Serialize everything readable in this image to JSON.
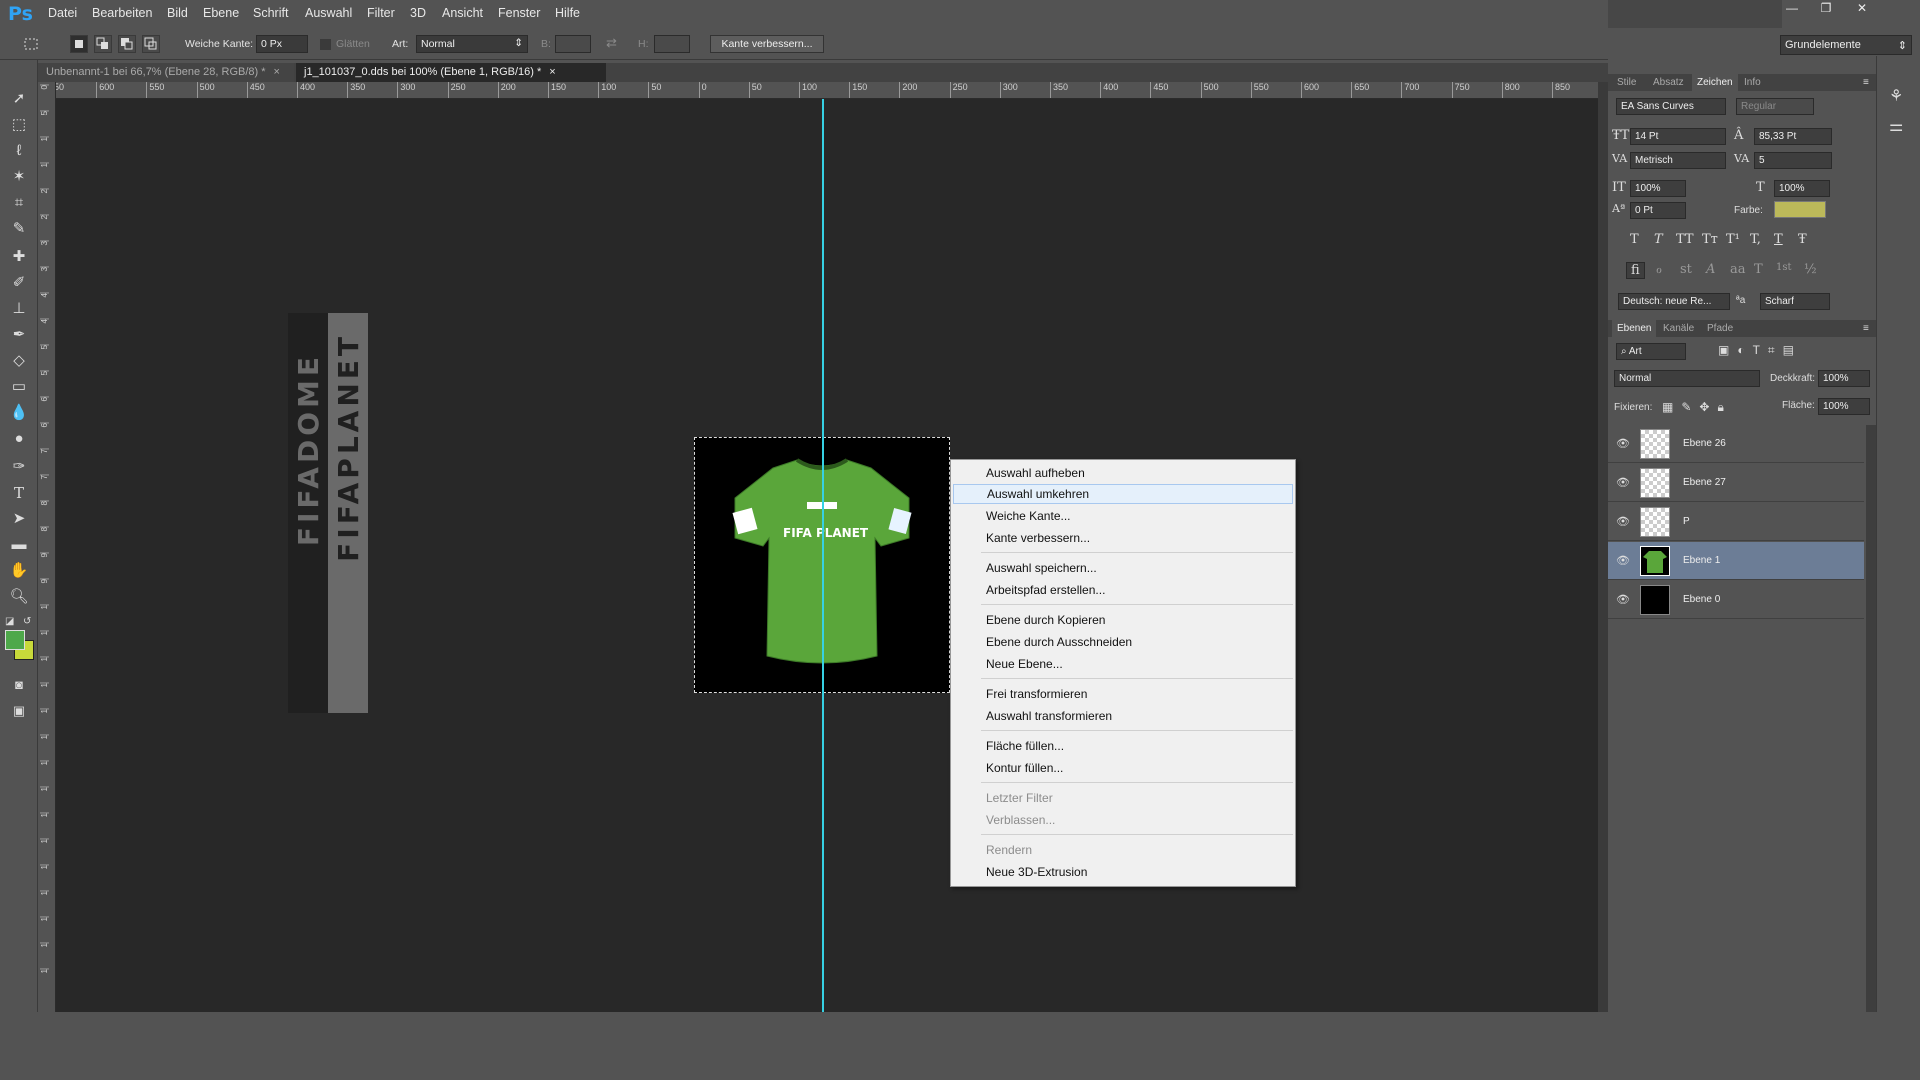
{
  "app": {
    "logo": "Ps"
  },
  "menu": [
    "Datei",
    "Bearbeiten",
    "Bild",
    "Ebene",
    "Schrift",
    "Auswahl",
    "Filter",
    "3D",
    "Ansicht",
    "Fenster",
    "Hilfe"
  ],
  "window_controls": {
    "minimize": "—",
    "restore": "❐",
    "close": "✕"
  },
  "options": {
    "feather_label": "Weiche Kante:",
    "feather_value": "0 Px",
    "antialias_label": "Glätten",
    "style_label": "Art:",
    "style_value": "Normal",
    "width_label": "B:",
    "height_label": "H:",
    "refine_button": "Kante verbessern..."
  },
  "workspace": "Grundelemente",
  "tabs": [
    {
      "label": "Unbenannt-1 bei 66,7% (Ebene 28, RGB/8) *",
      "close": "×"
    },
    {
      "label": "j1_101037_0.dds bei 100% (Ebene 1, RGB/16) *",
      "close": "×"
    }
  ],
  "ruler_h": [
    "650",
    "600",
    "550",
    "500",
    "450",
    "400",
    "350",
    "300",
    "250",
    "200",
    "150",
    "100",
    "50",
    "0",
    "50",
    "100",
    "150",
    "200",
    "250",
    "300",
    "350",
    "400",
    "450",
    "500",
    "550",
    "600",
    "650",
    "700",
    "750",
    "800",
    "850"
  ],
  "ruler_v": [
    "0",
    "5",
    "1",
    "1",
    "2",
    "2",
    "3",
    "3",
    "4",
    "4",
    "5",
    "5",
    "6",
    "6",
    "7",
    "7",
    "8",
    "8",
    "9",
    "9",
    "1",
    "1",
    "1",
    "1",
    "1",
    "1",
    "1",
    "1",
    "1",
    "1",
    "1",
    "1",
    "1",
    "1",
    "1"
  ],
  "canvas_logo": {
    "text_dark": "FIFADOME",
    "text_light": "FIFAPLANET"
  },
  "jersey_text": "FIFA PLANET",
  "context_menu": [
    {
      "label": "Auswahl aufheben",
      "disabled": false
    },
    {
      "label": "Auswahl umkehren",
      "disabled": false,
      "hover": true
    },
    {
      "label": "Weiche Kante...",
      "disabled": false
    },
    {
      "label": "Kante verbessern...",
      "disabled": false
    },
    {
      "label": "Auswahl speichern...",
      "disabled": false
    },
    {
      "label": "Arbeitspfad erstellen...",
      "disabled": false
    },
    {
      "label": "Ebene durch Kopieren",
      "disabled": false
    },
    {
      "label": "Ebene durch Ausschneiden",
      "disabled": false
    },
    {
      "label": "Neue Ebene...",
      "disabled": false
    },
    {
      "label": "Frei transformieren",
      "disabled": false
    },
    {
      "label": "Auswahl transformieren",
      "disabled": false
    },
    {
      "label": "Fläche füllen...",
      "disabled": false
    },
    {
      "label": "Kontur füllen...",
      "disabled": false
    },
    {
      "label": "Letzter Filter",
      "disabled": true
    },
    {
      "label": "Verblassen...",
      "disabled": true
    },
    {
      "label": "Rendern",
      "disabled": true
    },
    {
      "label": "Neue 3D-Extrusion",
      "disabled": false
    }
  ],
  "char_panel": {
    "tabs": [
      "Stile",
      "Absatz",
      "Zeichen",
      "Info"
    ],
    "font_family": "EA Sans Curves",
    "font_style": "Regular",
    "size": "14 Pt",
    "leading": "85,33 Pt",
    "kerning": "Metrisch",
    "tracking": "5",
    "vscale": "100%",
    "hscale": "100%",
    "baseline": "0 Pt",
    "color_label": "Farbe:",
    "color": "#bcb95a",
    "style_buttons": [
      "T",
      "T",
      "TT",
      "Tт",
      "T¹",
      "T,",
      "T",
      "Ŧ"
    ],
    "opentype_buttons": [
      "fi",
      "ℴ",
      "st",
      "A",
      "aa",
      "T",
      "1st",
      "½"
    ],
    "language": "Deutsch: neue Re...",
    "aa_label": "ªa",
    "antialias": "Scharf"
  },
  "layers_panel": {
    "tabs": [
      "Ebenen",
      "Kanäle",
      "Pfade"
    ],
    "filter": "Art",
    "blend": "Normal",
    "opacity_label": "Deckkraft:",
    "opacity": "100%",
    "lock_label": "Fixieren:",
    "fill_label": "Fläche:",
    "fill": "100%",
    "layers": [
      {
        "name": "Ebene 26",
        "thumb": "transparent"
      },
      {
        "name": "Ebene 27",
        "thumb": "transparent"
      },
      {
        "name": "P",
        "thumb": "transparent"
      },
      {
        "name": "Ebene 1",
        "thumb": "jersey",
        "selected": true
      },
      {
        "name": "Ebene 0",
        "thumb": "black"
      }
    ]
  },
  "colors": {
    "foreground": "#4ea84a",
    "background": "#c8d93a",
    "guide": "#36d1e3",
    "jersey": "#5aa63a"
  }
}
